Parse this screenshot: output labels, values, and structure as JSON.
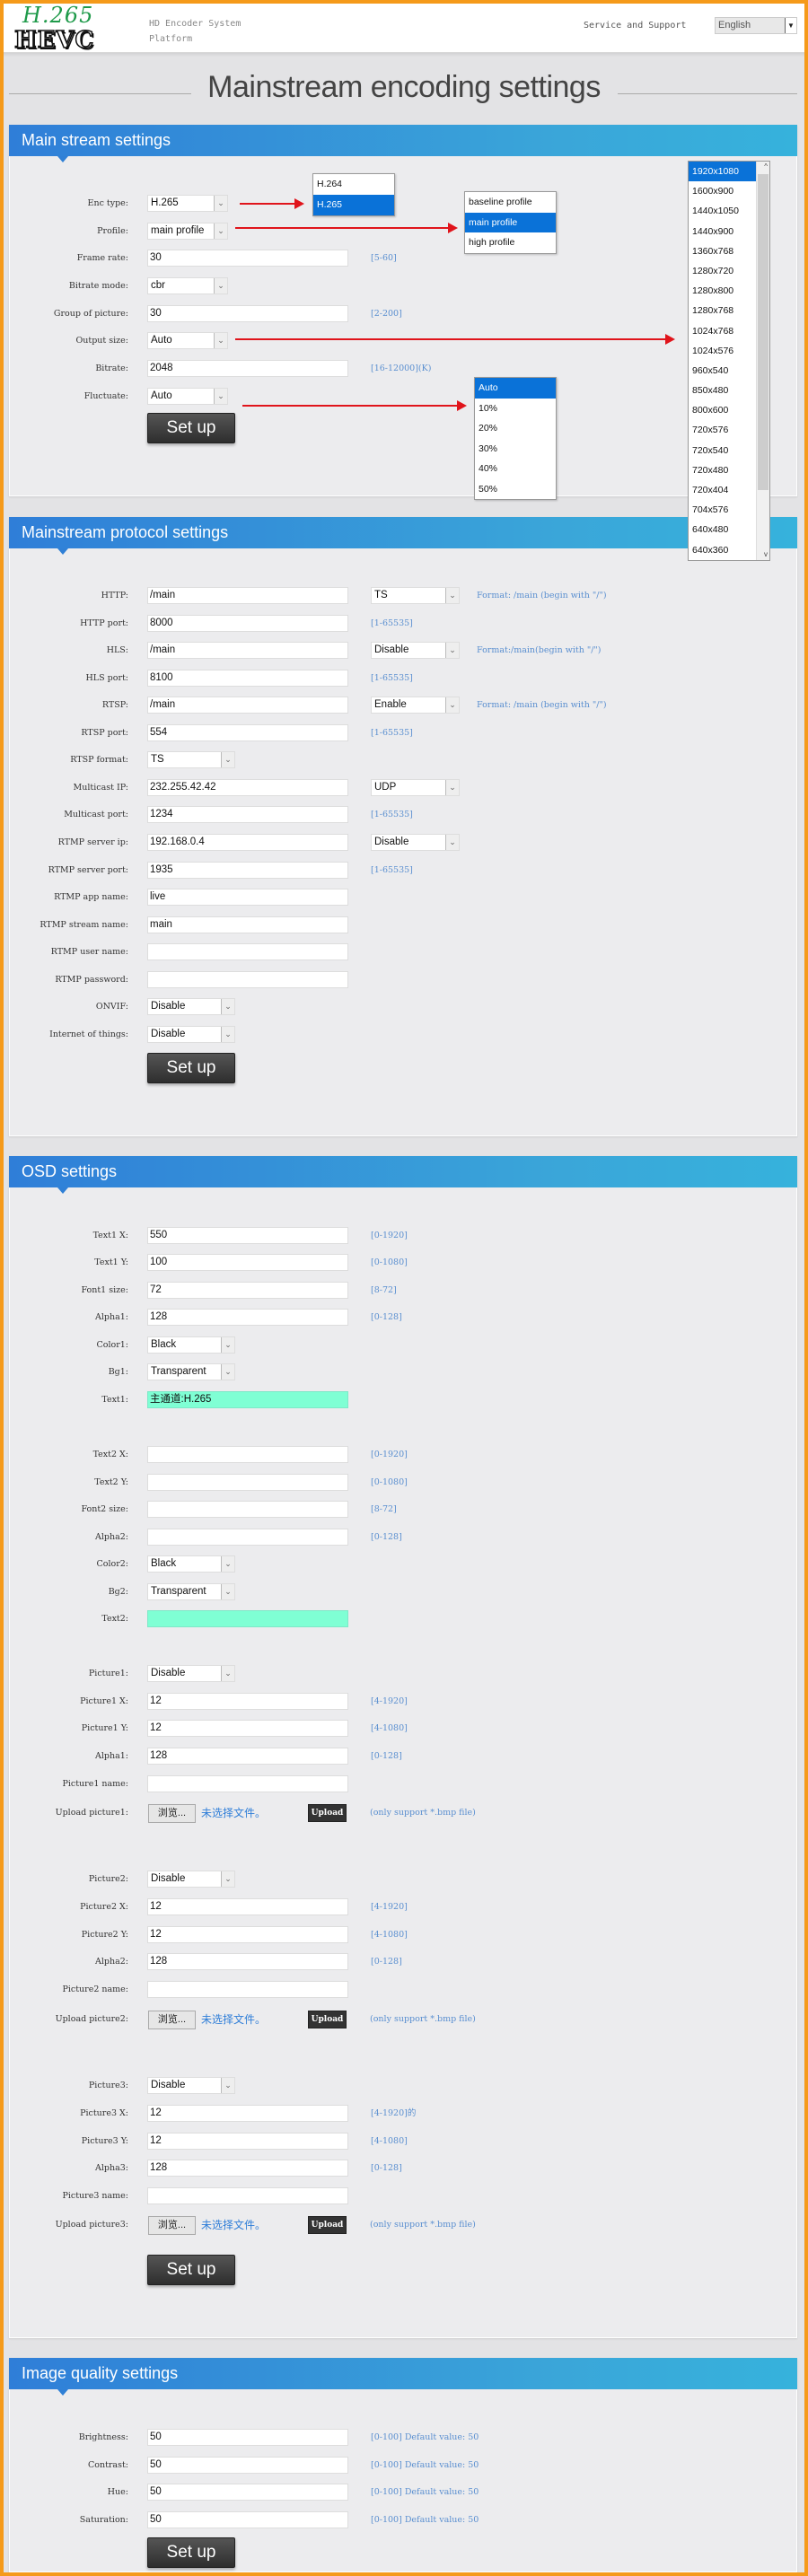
{
  "header": {
    "logo_top": "H.265",
    "logo_bottom": "HEVC",
    "system_line1": "HD Encoder System",
    "system_line2": "Platform",
    "service_link": "Service and Support",
    "language": "English"
  },
  "page_title": "Mainstream encoding settings",
  "colors": {
    "accent": "#2f7ed8",
    "frame": "#f59a1a",
    "highlight": "#0a72d8",
    "annotation_arrow": "#e0141b",
    "osd_text_bg": "#7fffd4"
  },
  "sections": [
    {
      "title": "Main stream settings",
      "button": "Set up",
      "rows": [
        {
          "label": "Enc type:",
          "type": "select",
          "value": "H.265"
        },
        {
          "label": "Profile:",
          "type": "select",
          "value": "main profile"
        },
        {
          "label": "Frame rate:",
          "type": "text",
          "value": "30",
          "hint": "[5-60]"
        },
        {
          "label": "Bitrate mode:",
          "type": "select",
          "value": "cbr"
        },
        {
          "label": "Group of picture:",
          "type": "text",
          "value": "30",
          "hint": "[2-200]"
        },
        {
          "label": "Output size:",
          "type": "select",
          "value": "Auto"
        },
        {
          "label": "Bitrate:",
          "type": "text",
          "value": "2048",
          "hint": "[16-12000](K)"
        },
        {
          "label": "Fluctuate:",
          "type": "select",
          "value": "Auto"
        }
      ]
    },
    {
      "title": "Mainstream protocol settings",
      "button": "Set up",
      "rows": [
        {
          "label": "HTTP:",
          "type": "text",
          "value": "/main",
          "select2": "TS",
          "hint": "Format: /main (begin with \"/\")"
        },
        {
          "label": "HTTP port:",
          "type": "text",
          "value": "8000",
          "hint": "[1-65535]"
        },
        {
          "label": "HLS:",
          "type": "text",
          "value": "/main",
          "select2": "Disable",
          "hint": "Format:/main(begin with \"/\")"
        },
        {
          "label": "HLS port:",
          "type": "text",
          "value": "8100",
          "hint": "[1-65535]"
        },
        {
          "label": "RTSP:",
          "type": "text",
          "value": "/main",
          "select2": "Enable",
          "hint": "Format: /main (begin with \"/\")"
        },
        {
          "label": "RTSP port:",
          "type": "text",
          "value": "554",
          "hint": "[1-65535]"
        },
        {
          "label": "RTSP format:",
          "type": "select",
          "value": "TS"
        },
        {
          "label": "Multicast IP:",
          "type": "text",
          "value": "232.255.42.42",
          "select2": "UDP"
        },
        {
          "label": "Multicast port:",
          "type": "text",
          "value": "1234",
          "hint": "[1-65535]"
        },
        {
          "label": "RTMP server ip:",
          "type": "text",
          "value": "192.168.0.4",
          "select2": "Disable"
        },
        {
          "label": "RTMP server port:",
          "type": "text",
          "value": "1935",
          "hint": "[1-65535]"
        },
        {
          "label": "RTMP app name:",
          "type": "text",
          "value": "live"
        },
        {
          "label": "RTMP stream name:",
          "type": "text",
          "value": "main"
        },
        {
          "label": "RTMP user name:",
          "type": "text",
          "value": ""
        },
        {
          "label": "RTMP password:",
          "type": "text",
          "value": ""
        },
        {
          "label": "ONVIF:",
          "type": "select",
          "value": "Disable"
        },
        {
          "label": "Internet of things:",
          "type": "select",
          "value": "Disable"
        }
      ]
    },
    {
      "title": "OSD settings",
      "button": "Set up",
      "rows": [
        {
          "label": "Text1 X:",
          "type": "text",
          "value": "550",
          "hint": "[0-1920]"
        },
        {
          "label": "Text1 Y:",
          "type": "text",
          "value": "100",
          "hint": "[0-1080]"
        },
        {
          "label": "Font1 size:",
          "type": "text",
          "value": "72",
          "hint": "[8-72]"
        },
        {
          "label": "Alpha1:",
          "type": "text",
          "value": "128",
          "hint": "[0-128]"
        },
        {
          "label": "Color1:",
          "type": "select",
          "value": "Black"
        },
        {
          "label": "Bg1:",
          "type": "select",
          "value": "Transparent"
        },
        {
          "label": "Text1:",
          "type": "osdtext",
          "value": "主通道:H.265"
        },
        {
          "label": "Text2 X:",
          "type": "text",
          "value": "",
          "hint": "[0-1920]"
        },
        {
          "label": "Text2 Y:",
          "type": "text",
          "value": "",
          "hint": "[0-1080]"
        },
        {
          "label": "Font2 size:",
          "type": "text",
          "value": "",
          "hint": "[8-72]"
        },
        {
          "label": "Alpha2:",
          "type": "text",
          "value": "",
          "hint": "[0-128]"
        },
        {
          "label": "Color2:",
          "type": "select",
          "value": "Black"
        },
        {
          "label": "Bg2:",
          "type": "select",
          "value": "Transparent"
        },
        {
          "label": "Text2:",
          "type": "osdtext",
          "value": ""
        },
        {
          "label": "Picture1:",
          "type": "select",
          "value": "Disable"
        },
        {
          "label": "Picture1 X:",
          "type": "text",
          "value": "12",
          "hint": "[4-1920]"
        },
        {
          "label": "Picture1 Y:",
          "type": "text",
          "value": "12",
          "hint": "[4-1080]"
        },
        {
          "label": "Alpha1:",
          "type": "text",
          "value": "128",
          "hint": "[0-128]"
        },
        {
          "label": "Picture1 name:",
          "type": "text",
          "value": ""
        },
        {
          "label": "Upload picture1:",
          "type": "file",
          "browse": "浏览...",
          "file_status": "未选择文件。",
          "upload": "Upload",
          "hint": "(only support *.bmp file)"
        },
        {
          "label": "Picture2:",
          "type": "select",
          "value": "Disable"
        },
        {
          "label": "Picture2 X:",
          "type": "text",
          "value": "12",
          "hint": "[4-1920]"
        },
        {
          "label": "Picture2 Y:",
          "type": "text",
          "value": "12",
          "hint": "[4-1080]"
        },
        {
          "label": "Alpha2:",
          "type": "text",
          "value": "128",
          "hint": "[0-128]"
        },
        {
          "label": "Picture2 name:",
          "type": "text",
          "value": ""
        },
        {
          "label": "Upload picture2:",
          "type": "file",
          "browse": "浏览...",
          "file_status": "未选择文件。",
          "upload": "Upload",
          "hint": "(only support *.bmp file)"
        },
        {
          "label": "Picture3:",
          "type": "select",
          "value": "Disable"
        },
        {
          "label": "Picture3 X:",
          "type": "text",
          "value": "12",
          "hint": "[4-1920]的"
        },
        {
          "label": "Picture3 Y:",
          "type": "text",
          "value": "12",
          "hint": "[4-1080]"
        },
        {
          "label": "Alpha3:",
          "type": "text",
          "value": "128",
          "hint": "[0-128]"
        },
        {
          "label": "Picture3 name:",
          "type": "text",
          "value": ""
        },
        {
          "label": "Upload picture3:",
          "type": "file",
          "browse": "浏览...",
          "file_status": "未选择文件。",
          "upload": "Upload",
          "hint": "(only support *.bmp file)"
        }
      ]
    },
    {
      "title": "Image quality settings",
      "button": "Set up",
      "rows": [
        {
          "label": "Brightness:",
          "type": "text",
          "value": "50",
          "hint": "[0-100] Default value: 50"
        },
        {
          "label": "Contrast:",
          "type": "text",
          "value": "50",
          "hint": "[0-100] Default value: 50"
        },
        {
          "label": "Hue:",
          "type": "text",
          "value": "50",
          "hint": "[0-100] Default value: 50"
        },
        {
          "label": "Saturation:",
          "type": "text",
          "value": "50",
          "hint": "[0-100] Default value: 50"
        }
      ]
    }
  ],
  "dropdowns": {
    "enc_type": {
      "options": [
        "H.264",
        "H.265"
      ],
      "selected": "H.265"
    },
    "profile": {
      "options": [
        "baseline profile",
        "main profile",
        "high profile"
      ],
      "selected": "main profile"
    },
    "fluctuate": {
      "options": [
        "Auto",
        "10%",
        "20%",
        "30%",
        "40%",
        "50%"
      ],
      "selected": "Auto"
    },
    "output_size": {
      "options": [
        "1920x1080",
        "1600x900",
        "1440x1050",
        "1440x900",
        "1360x768",
        "1280x720",
        "1280x800",
        "1280x768",
        "1024x768",
        "1024x576",
        "960x540",
        "850x480",
        "800x600",
        "720x576",
        "720x540",
        "720x480",
        "720x404",
        "704x576",
        "640x480",
        "640x360"
      ],
      "selected": "1920x1080"
    }
  }
}
